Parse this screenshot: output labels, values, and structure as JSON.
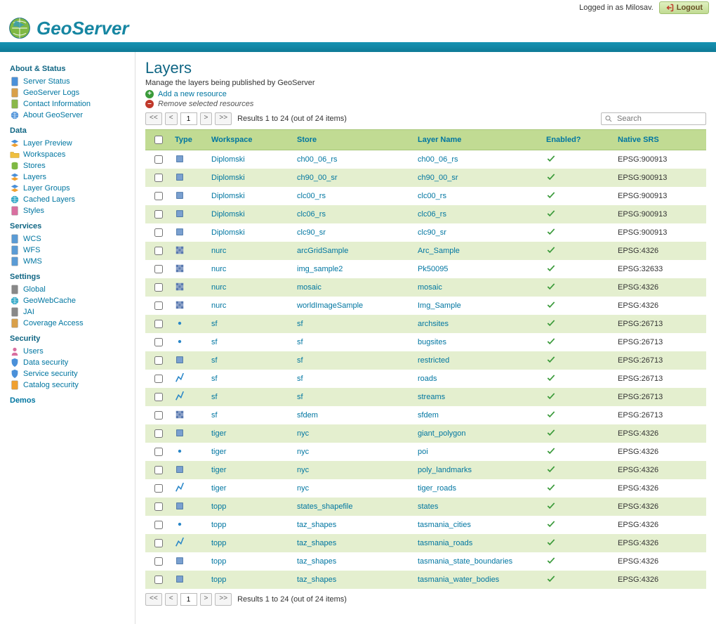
{
  "top": {
    "logged_in": "Logged in as Milosav.",
    "logout": "Logout"
  },
  "app_name": "GeoServer",
  "nav": {
    "about": {
      "title": "About & Status",
      "items": [
        "Server Status",
        "GeoServer Logs",
        "Contact Information",
        "About GeoServer"
      ]
    },
    "data": {
      "title": "Data",
      "items": [
        "Layer Preview",
        "Workspaces",
        "Stores",
        "Layers",
        "Layer Groups",
        "Cached Layers",
        "Styles"
      ]
    },
    "services": {
      "title": "Services",
      "items": [
        "WCS",
        "WFS",
        "WMS"
      ]
    },
    "settings": {
      "title": "Settings",
      "items": [
        "Global",
        "GeoWebCache",
        "JAI",
        "Coverage Access"
      ]
    },
    "security": {
      "title": "Security",
      "items": [
        "Users",
        "Data security",
        "Service security",
        "Catalog security"
      ]
    },
    "demos": {
      "title": "Demos"
    }
  },
  "page": {
    "title": "Layers",
    "subtitle": "Manage the layers being published by GeoServer",
    "add": "Add a new resource",
    "remove": "Remove selected resources",
    "results": "Results 1 to 24 (out of 24 items)",
    "page_num": "1",
    "search_placeholder": "Search"
  },
  "headers": {
    "type": "Type",
    "workspace": "Workspace",
    "store": "Store",
    "layer": "Layer Name",
    "enabled": "Enabled?",
    "srs": "Native SRS"
  },
  "rows": [
    {
      "type": "polygon",
      "ws": "Diplomski",
      "store": "ch00_06_rs",
      "layer": "ch00_06_rs",
      "srs": "EPSG:900913"
    },
    {
      "type": "polygon",
      "ws": "Diplomski",
      "store": "ch90_00_sr",
      "layer": "ch90_00_sr",
      "srs": "EPSG:900913"
    },
    {
      "type": "polygon",
      "ws": "Diplomski",
      "store": "clc00_rs",
      "layer": "clc00_rs",
      "srs": "EPSG:900913"
    },
    {
      "type": "polygon",
      "ws": "Diplomski",
      "store": "clc06_rs",
      "layer": "clc06_rs",
      "srs": "EPSG:900913"
    },
    {
      "type": "polygon",
      "ws": "Diplomski",
      "store": "clc90_sr",
      "layer": "clc90_sr",
      "srs": "EPSG:900913"
    },
    {
      "type": "raster",
      "ws": "nurc",
      "store": "arcGridSample",
      "layer": "Arc_Sample",
      "srs": "EPSG:4326"
    },
    {
      "type": "raster",
      "ws": "nurc",
      "store": "img_sample2",
      "layer": "Pk50095",
      "srs": "EPSG:32633"
    },
    {
      "type": "raster",
      "ws": "nurc",
      "store": "mosaic",
      "layer": "mosaic",
      "srs": "EPSG:4326"
    },
    {
      "type": "raster",
      "ws": "nurc",
      "store": "worldImageSample",
      "layer": "Img_Sample",
      "srs": "EPSG:4326"
    },
    {
      "type": "point",
      "ws": "sf",
      "store": "sf",
      "layer": "archsites",
      "srs": "EPSG:26713"
    },
    {
      "type": "point",
      "ws": "sf",
      "store": "sf",
      "layer": "bugsites",
      "srs": "EPSG:26713"
    },
    {
      "type": "polygon",
      "ws": "sf",
      "store": "sf",
      "layer": "restricted",
      "srs": "EPSG:26713"
    },
    {
      "type": "line",
      "ws": "sf",
      "store": "sf",
      "layer": "roads",
      "srs": "EPSG:26713"
    },
    {
      "type": "line",
      "ws": "sf",
      "store": "sf",
      "layer": "streams",
      "srs": "EPSG:26713"
    },
    {
      "type": "raster",
      "ws": "sf",
      "store": "sfdem",
      "layer": "sfdem",
      "srs": "EPSG:26713"
    },
    {
      "type": "polygon",
      "ws": "tiger",
      "store": "nyc",
      "layer": "giant_polygon",
      "srs": "EPSG:4326"
    },
    {
      "type": "point",
      "ws": "tiger",
      "store": "nyc",
      "layer": "poi",
      "srs": "EPSG:4326"
    },
    {
      "type": "polygon",
      "ws": "tiger",
      "store": "nyc",
      "layer": "poly_landmarks",
      "srs": "EPSG:4326"
    },
    {
      "type": "line",
      "ws": "tiger",
      "store": "nyc",
      "layer": "tiger_roads",
      "srs": "EPSG:4326"
    },
    {
      "type": "polygon",
      "ws": "topp",
      "store": "states_shapefile",
      "layer": "states",
      "srs": "EPSG:4326"
    },
    {
      "type": "point",
      "ws": "topp",
      "store": "taz_shapes",
      "layer": "tasmania_cities",
      "srs": "EPSG:4326"
    },
    {
      "type": "line",
      "ws": "topp",
      "store": "taz_shapes",
      "layer": "tasmania_roads",
      "srs": "EPSG:4326"
    },
    {
      "type": "polygon",
      "ws": "topp",
      "store": "taz_shapes",
      "layer": "tasmania_state_boundaries",
      "srs": "EPSG:4326"
    },
    {
      "type": "polygon",
      "ws": "topp",
      "store": "taz_shapes",
      "layer": "tasmania_water_bodies",
      "srs": "EPSG:4326"
    }
  ]
}
